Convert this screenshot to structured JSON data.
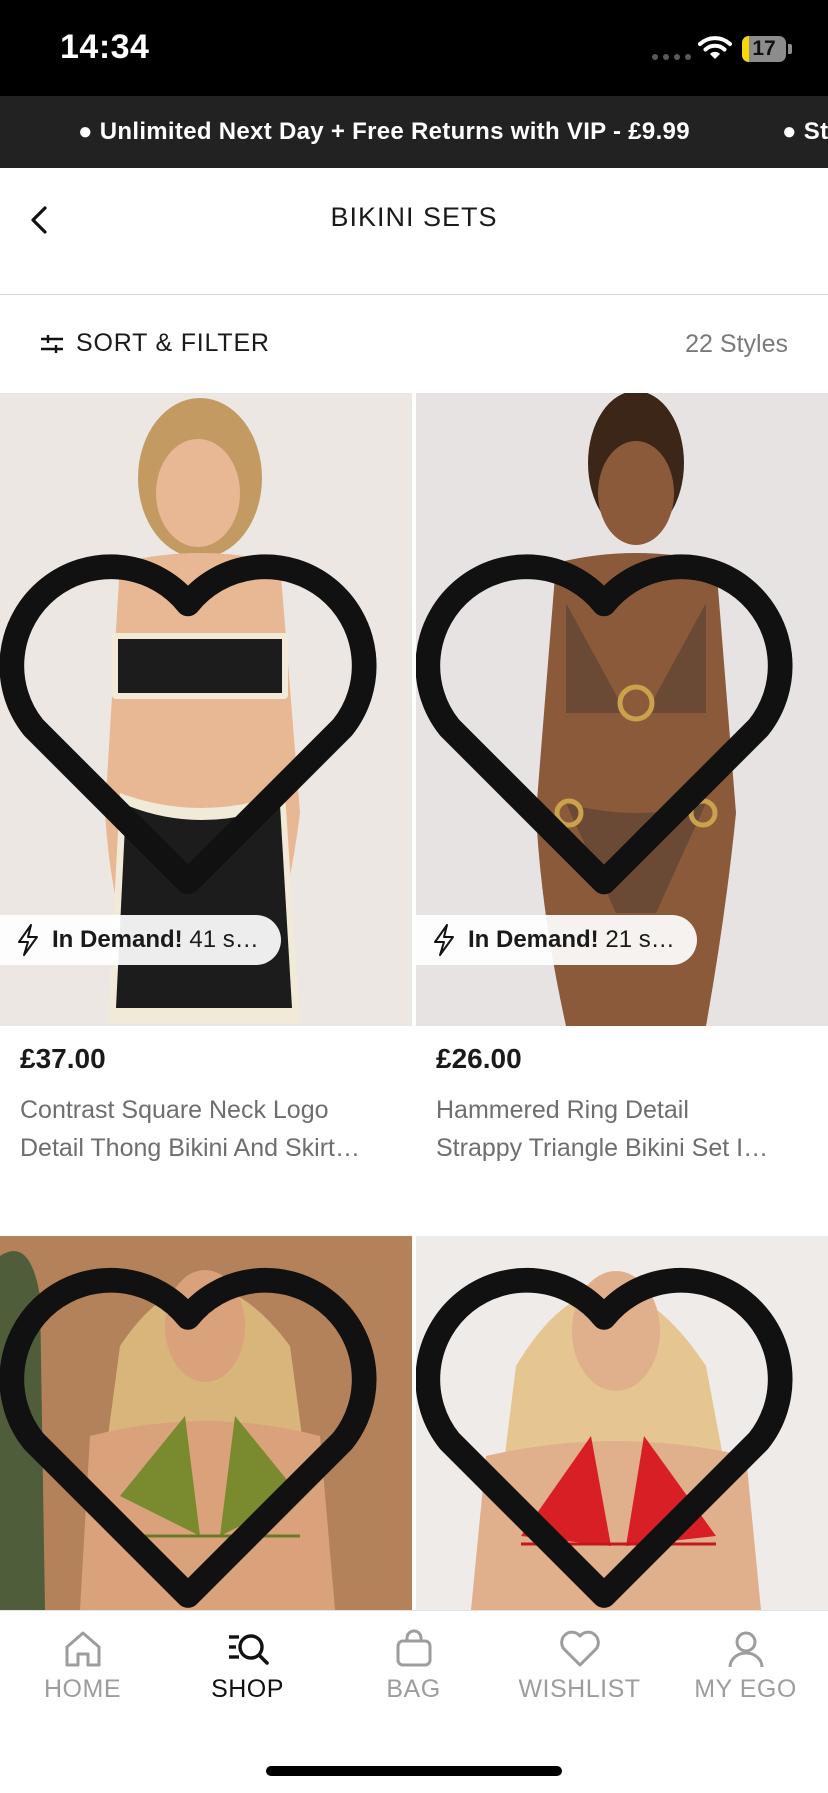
{
  "status_bar": {
    "time": "14:34",
    "battery": "17",
    "battery_level": 0.17
  },
  "promo_banner": {
    "items": [
      "Unlimited Next Day + Free Returns with VIP - £9.99",
      "St"
    ]
  },
  "header": {
    "title": "BIKINI SETS"
  },
  "filter_bar": {
    "sort_filter_label": "SORT & FILTER",
    "styles_count": "22 Styles"
  },
  "products": [
    {
      "price": "£37.00",
      "name_line1": "Contrast Square Neck Logo",
      "name_line2": "Detail Thong Bikini And Skirt…",
      "badge_label": "In Demand!",
      "badge_detail": "41 s…",
      "image_colors": {
        "bg": "#ece7e2",
        "garment": "#1c1c1c",
        "trim": "#f1ead9",
        "skin": "#e8b894",
        "hair": "#c49a63"
      }
    },
    {
      "price": "£26.00",
      "name_line1": "Hammered Ring Detail",
      "name_line2": "Strappy Triangle Bikini Set I…",
      "badge_label": "In Demand!",
      "badge_detail": "21 s…",
      "image_colors": {
        "bg": "#e7e3e3",
        "garment": "#6b4a35",
        "trim": "#c9a24b",
        "skin": "#8a5a3b",
        "hair": "#3b2618"
      }
    },
    {
      "image_colors": {
        "bg": "#b4825a",
        "garment": "#7a8a2e",
        "trim": "#6a7a26",
        "skin": "#d9a27a",
        "hair": "#d8b57a"
      }
    },
    {
      "image_colors": {
        "bg": "#efebe8",
        "garment": "#d81f26",
        "trim": "#c01a20",
        "skin": "#e0b08c",
        "hair": "#e5c690"
      }
    }
  ],
  "tab_bar": {
    "tabs": [
      {
        "label": "HOME",
        "icon": "home-icon",
        "active": false
      },
      {
        "label": "SHOP",
        "icon": "search-icon",
        "active": true
      },
      {
        "label": "BAG",
        "icon": "bag-icon",
        "active": false
      },
      {
        "label": "WISHLIST",
        "icon": "heart-icon",
        "active": false
      },
      {
        "label": "MY EGO",
        "icon": "profile-icon",
        "active": false
      }
    ]
  }
}
